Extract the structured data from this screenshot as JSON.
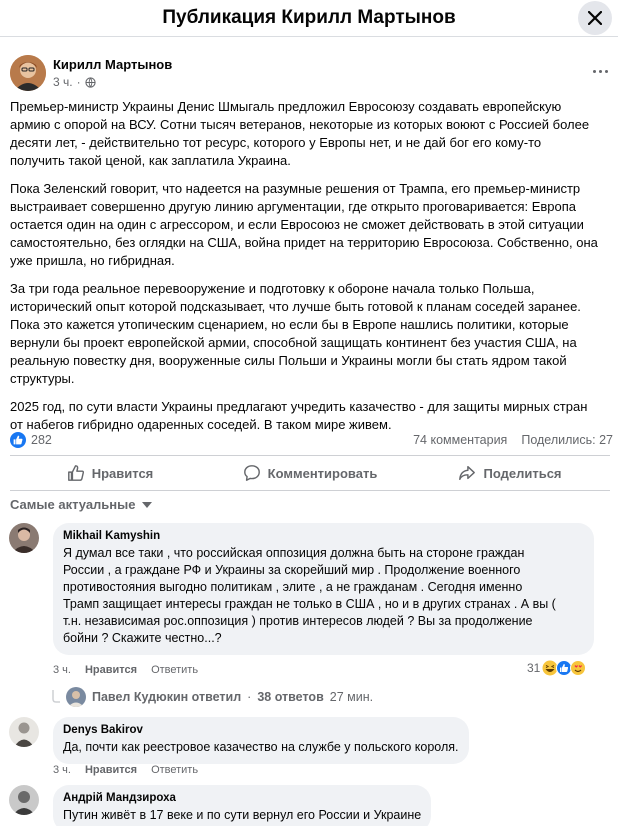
{
  "modal": {
    "title": "Публикация Кирилл Мартынов"
  },
  "post": {
    "author": "Кирилл Мартынов",
    "time": "3 ч.",
    "audience_icon": "globe-icon",
    "paragraphs": [
      "Премьер-министр Украины Денис Шмыгаль предложил Евросоюзу создавать европейскую\nармию с опорой на ВСУ. Сотни тысяч ветеранов, некоторые из которых воюют с Россией более\nдесяти лет, - действительно тот ресурс, которого у Европы нет, и не дай бог его кому-то\nполучить такой ценой, как заплатила Украина.",
      "Пока Зеленский говорит, что надеется на разумные решения от Трампа, его премьер-министр\nвыстраивает совершенно другую линию аргументации, где открыто проговаривается: Европа\nостается один на один с агрессором, и если Евросоюз не сможет действовать в этой ситуации\nсамостоятельно, без оглядки на США, война придет на территорию Евросоюза. Собственно, она\nуже пришла, но гибридная.",
      "За три года реальное перевооружение и подготовку к обороне начала только Польша,\nисторический опыт которой подсказывает, что лучше быть готовой к планам соседей заранее.\nПока это кажется утопическим сценарием, но если бы в Европе нашлись политики, которые\nвернули бы проект европейской армии, способной защищать континент без участия США, на\nреальную повестку дня, вооруженные силы Польши и Украины могли бы стать ядром такой\nструктуры.",
      "2025 год, по сути власти Украины предлагают учредить казачество - для защиты мирных стран\nот набегов гибридно одаренных соседей. В таком мире живем."
    ],
    "likes": "282",
    "comments_count": "74 комментария",
    "shares_count": "Поделились: 27"
  },
  "actions": {
    "like": "Нравится",
    "comment": "Комментировать",
    "share": "Поделиться"
  },
  "sort_label": "Самые актуальные",
  "comments": [
    {
      "name": "Mikhail Kamyshin",
      "text": "Я думал все таки , что российская оппозиция должна быть на стороне граждан\nРоссии , а граждане РФ и Украины за скорейший мир . Продолжение военного\nпротивостояния выгодно политикам , элите , а не гражданам . Сегодня именно\nТрамп защищает интересы граждан не только в США , но и в других странах . А вы (\nт.н. независимая рос.оппозиция ) против интересов людей ? Вы за продолжение\nбойни ? Скажите честно...?",
      "time": "3 ч.",
      "like": "Нравится",
      "reply": "Ответить",
      "reactions_count": "31",
      "reply_author": "Павел Кудюкин ответил",
      "replies": "38 ответов",
      "reply_time": "27 мин."
    },
    {
      "name": "Denys Bakirov",
      "text": "Да, почти как реестровое казачество на службе у польского короля.",
      "time": "3 ч.",
      "like": "Нравится",
      "reply": "Ответить"
    },
    {
      "name": "Андрій Мандзироха",
      "text": "Путин живёт в 17 веке и по сути вернул его России и Украине"
    }
  ],
  "colors": {
    "brand": "#1877f2",
    "secondary_text": "#65676b",
    "bubble": "#f0f2f5"
  }
}
